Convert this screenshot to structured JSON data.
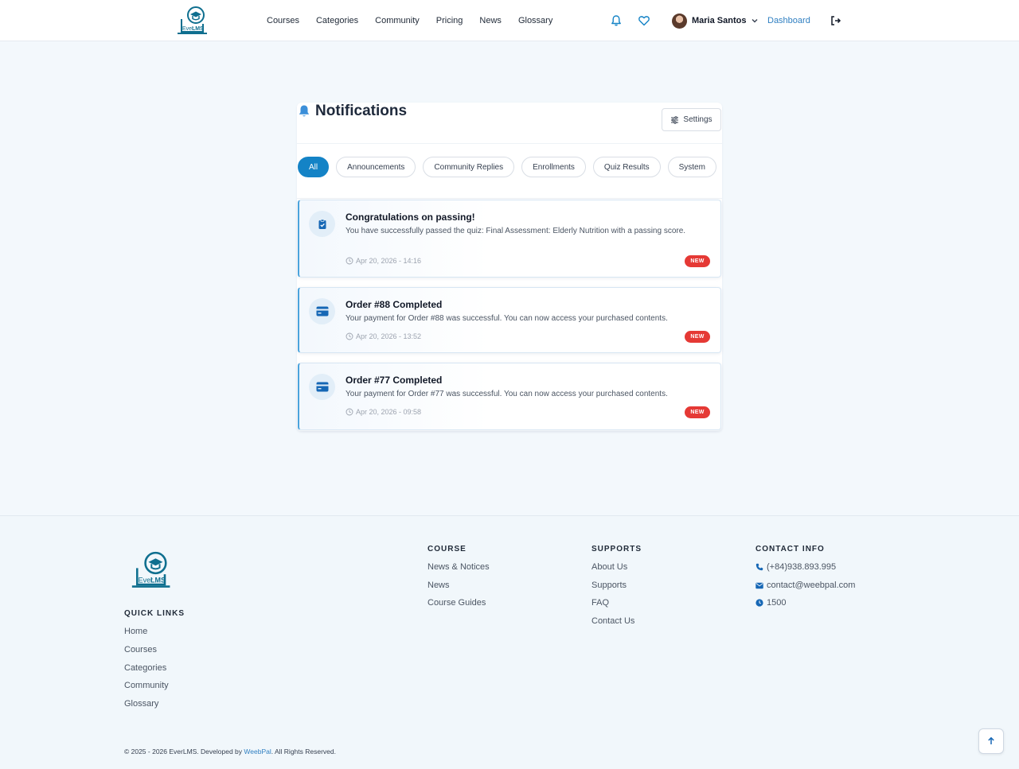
{
  "brand": {
    "logo_text_ever": "Ever",
    "logo_text_lms": "LMS"
  },
  "nav": {
    "items": [
      "Courses",
      "Categories",
      "Community",
      "Pricing",
      "News",
      "Glossary"
    ]
  },
  "header": {
    "user_name": "Maria Santos",
    "dashboard_label": "Dashboard"
  },
  "notifications": {
    "title": "Notifications",
    "settings_label": "Settings",
    "filters": [
      "All",
      "Announcements",
      "Community Replies",
      "Enrollments",
      "Quiz Results",
      "System"
    ],
    "active_filter": "All",
    "items": [
      {
        "icon": "clipboard-check-icon",
        "title": "Congratulations on passing!",
        "body": "You have successfully passed the quiz: Final Assessment: Elderly Nutrition with a passing score.",
        "time": "Apr 20, 2026 - 14:16",
        "badge": "NEW"
      },
      {
        "icon": "credit-card-icon",
        "title": "Order #88 Completed",
        "body": "Your payment for Order #88 was successful. You can now access your purchased contents.",
        "time": "Apr 20, 2026 - 13:52",
        "badge": "NEW"
      },
      {
        "icon": "credit-card-icon",
        "title": "Order #77 Completed",
        "body": "Your payment for Order #77 was successful. You can now access your purchased contents.",
        "time": "Apr 20, 2026 - 09:58",
        "badge": "NEW"
      }
    ]
  },
  "footer": {
    "quick_links": {
      "heading": "QUICK LINKS",
      "items": [
        "Home",
        "Courses",
        "Categories",
        "Community",
        "Glossary"
      ]
    },
    "course": {
      "heading": "COURSE",
      "items": [
        "News & Notices",
        "News",
        "Course Guides"
      ]
    },
    "supports": {
      "heading": "SUPPORTS",
      "items": [
        "About Us",
        "Supports",
        "FAQ",
        "Contact Us"
      ]
    },
    "contact": {
      "heading": "CONTACT INFO",
      "phone": "(+84)938.893.995",
      "email": "contact@weebpal.com",
      "hours": "1500"
    },
    "copyright_prefix": "© 2025 - 2026 EverLMS. Developed by ",
    "developer": "WeebPal",
    "copyright_suffix": ". All Rights Reserved."
  },
  "colors": {
    "accent": "#1483c6",
    "badge": "#e53935",
    "link": "#2f7fc1"
  }
}
